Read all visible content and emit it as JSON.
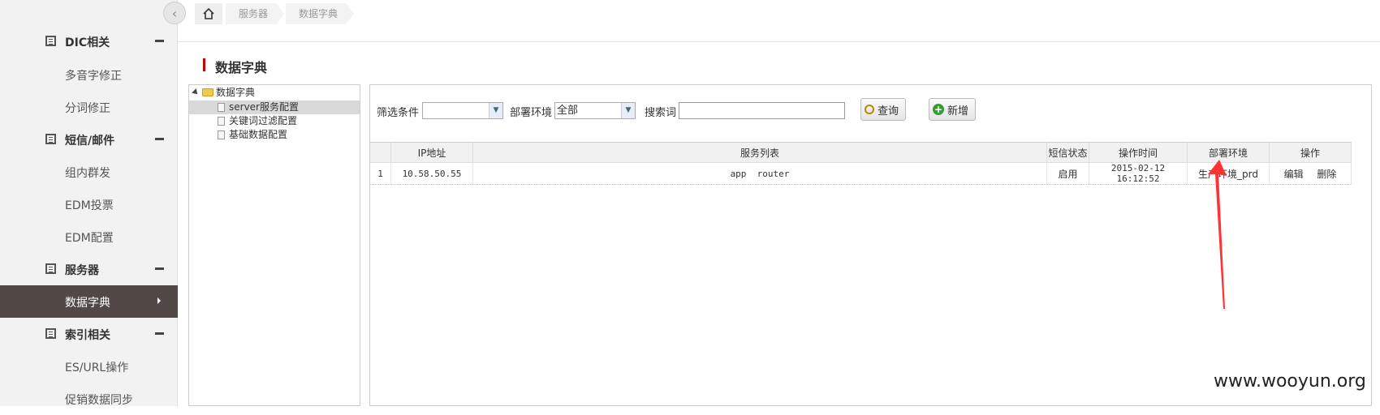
{
  "sidebar": {
    "collapse_icon": "chevron-left-icon",
    "groups": [
      {
        "label": "DIC相关",
        "items": [
          "多音字修正",
          "分词修正"
        ]
      },
      {
        "label": "短信/邮件",
        "items": [
          "组内群发",
          "EDM投票",
          "EDM配置"
        ]
      },
      {
        "label": "服务器",
        "items": [
          "数据字典"
        ]
      },
      {
        "label": "索引相关",
        "items": [
          "ES/URL操作",
          "促销数据同步"
        ]
      }
    ],
    "active_item": "数据字典",
    "active_color": "#524846"
  },
  "breadcrumb": {
    "home_icon": "home-icon",
    "items": [
      "服务器",
      "数据字典"
    ]
  },
  "page": {
    "title": "数据字典",
    "title_accent": "#cc0000"
  },
  "tree": {
    "root": "数据字典",
    "children": [
      "server服务配置",
      "关键词过滤配置",
      "基础数据配置"
    ],
    "selected": "server服务配置"
  },
  "toolbar": {
    "filter_label": "筛选条件",
    "filter_value": "",
    "env_label": "部署环境",
    "env_value": "全部",
    "search_label": "搜索词",
    "search_value": "",
    "query_button": "查询",
    "add_button": "新增"
  },
  "table": {
    "columns": [
      "",
      "IP地址",
      "服务列表",
      "短信状态",
      "操作时间",
      "部署环境",
      "操作"
    ],
    "rows": [
      {
        "index": "1",
        "ip": "10.58.50.55",
        "services": "app  router",
        "sms_status": "启用",
        "time": "2015-02-12 16:12:52",
        "env": "生产环境_prd",
        "actions": [
          "编辑",
          "删除"
        ]
      }
    ]
  },
  "annotation": {
    "arrow_color": "#ff3333"
  },
  "watermark": "www.wooyun.org"
}
